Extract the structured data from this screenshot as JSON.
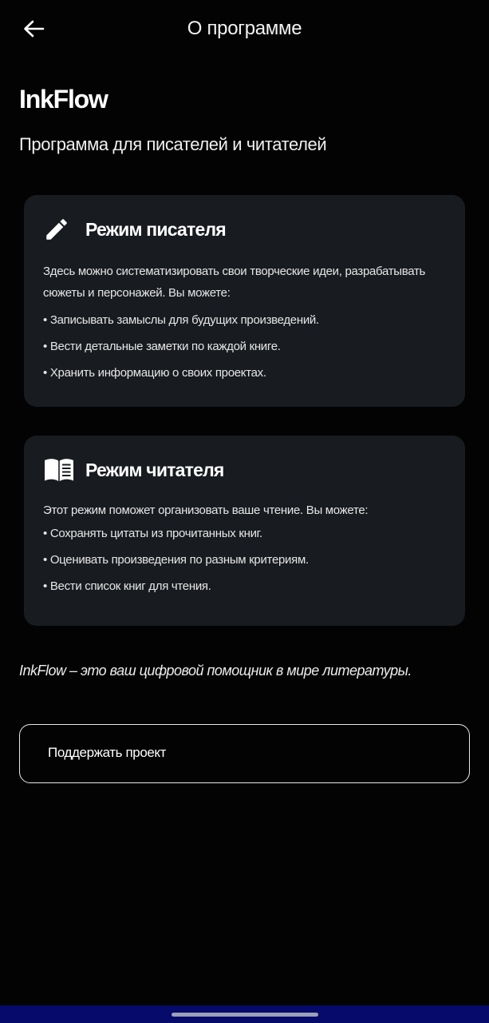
{
  "topbar": {
    "title": "О программе",
    "back_icon": "arrow-left-icon"
  },
  "app": {
    "name": "InkFlow",
    "subtitle": "Программа для писателей и читателей"
  },
  "cards": {
    "writer": {
      "icon": "pencil-icon",
      "title": "Режим писателя",
      "description": "Здесь можно систематизировать свои творческие идеи, разрабатывать сюжеты и персонажей. Вы можете:",
      "bullets": [
        "• Записывать замыслы для будущих произведений.",
        "• Вести детальные заметки по каждой книге.",
        "• Хранить информацию о своих проектах."
      ]
    },
    "reader": {
      "icon": "book-icon",
      "title": "Режим читателя",
      "description": "Этот режим поможет организовать ваше чтение. Вы можете:",
      "bullets": [
        "• Сохранять цитаты из прочитанных книг.",
        "• Оценивать произведения по разным критериям.",
        "• Вести список книг для чтения."
      ]
    }
  },
  "tagline": "InkFlow – это ваш цифровой помощник в мире литературы.",
  "support_button": {
    "label": "Поддержать проект"
  },
  "colors": {
    "background": "#030303",
    "card": "#181c20",
    "navbar": "#060a6b"
  }
}
